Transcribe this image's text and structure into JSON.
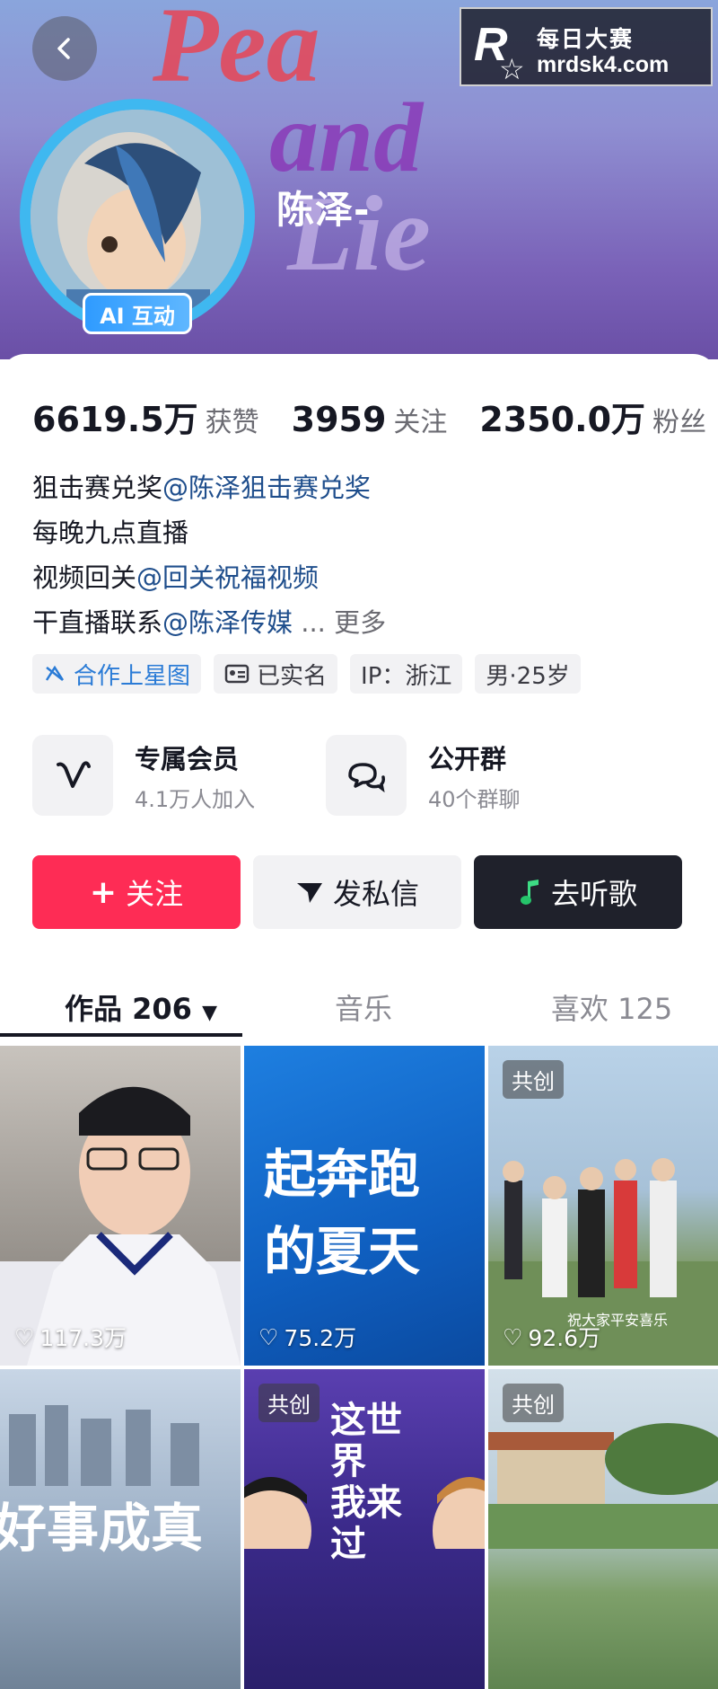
{
  "header": {
    "username": "陈泽-",
    "ai_badge": "AI 互动",
    "watermark_title": "每日大赛",
    "watermark_domain": "mrdsk4.com",
    "watermark_logo": "R"
  },
  "stats": [
    {
      "value": "6619.5万",
      "label": "获赞"
    },
    {
      "value": "3959",
      "label": "关注"
    },
    {
      "value": "2350.0万",
      "label": "粉丝"
    }
  ],
  "bio": {
    "line1_text": "狙击赛兑奖",
    "line1_mention": "@陈泽狙击赛兑奖",
    "line2_text": "每晚九点直播",
    "line3_text": "视频回关",
    "line3_mention": "@回关祝福视频",
    "line4_text": "干直播联系",
    "line4_mention": "@陈泽传媒",
    "ellipsis": "...",
    "more": "更多"
  },
  "tags": [
    {
      "label": "合作上星图",
      "icon": "star-map-icon"
    },
    {
      "label": "已实名",
      "icon": "id-card-icon"
    },
    {
      "label": "IP：浙江",
      "icon": ""
    },
    {
      "label": "男·25岁",
      "icon": ""
    }
  ],
  "features": {
    "member_title": "专属会员",
    "member_sub": "4.1万人加入",
    "group_title": "公开群",
    "group_sub": "40个群聊"
  },
  "actions": {
    "follow": "关注",
    "message": "发私信",
    "song": "去听歌"
  },
  "tabs": {
    "works": "作品 206",
    "music": "音乐",
    "likes": "喜欢 125"
  },
  "videos": [
    {
      "likes": "117.3万",
      "badge": "",
      "text": ""
    },
    {
      "likes": "75.2万",
      "badge": "",
      "text": "起奔跑 的夏天"
    },
    {
      "likes": "92.6万",
      "badge": "共创",
      "text": "祝大家平安喜乐"
    },
    {
      "likes": "",
      "badge": "",
      "text": "好事成真"
    },
    {
      "likes": "",
      "badge": "共创",
      "text": "这世界 我来过"
    },
    {
      "likes": "",
      "badge": "共创",
      "text": ""
    }
  ],
  "colors": {
    "follow_button": "#fe2c55",
    "mention": "#1f4e8c",
    "ai_badge": "#2f9bff",
    "avatar_ring": "#3fb8f0"
  }
}
